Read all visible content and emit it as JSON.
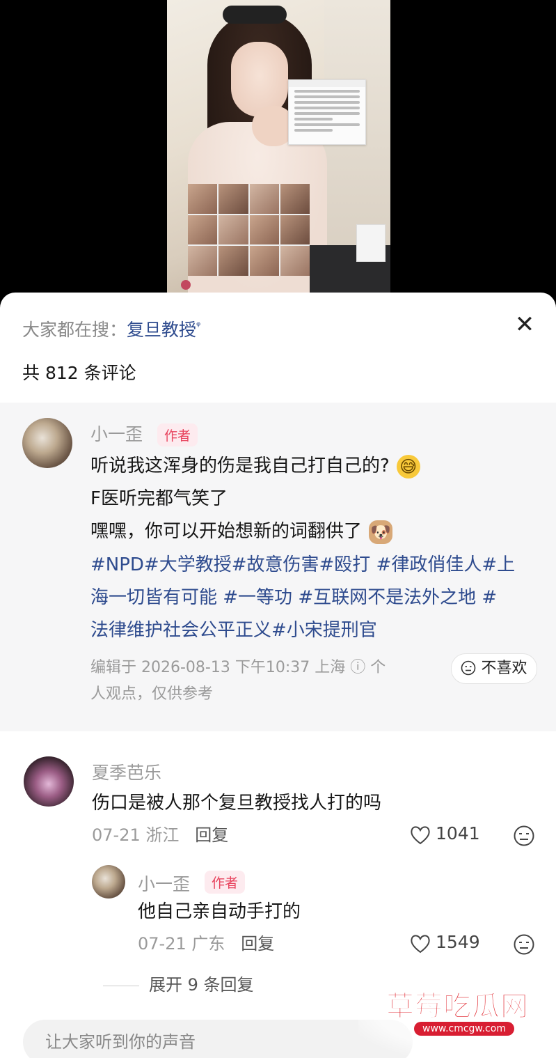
{
  "sheet": {
    "search_prefix": "大家都在搜：",
    "search_keyword": "复旦教授",
    "search_icon": "ᵠ",
    "close_icon": "✕",
    "comment_count": "共 812 条评论"
  },
  "pinned": {
    "username": "小一歪",
    "badge": "作者",
    "line1": "听说我这浑身的伤是我自己打自己的?",
    "line2": "F医听完都气笑了",
    "line3": "嘿嘿，你可以开始想新的词翻供了",
    "hashtag_line1": "#NPD#大学教授#故意伤害#殴打 #律政俏佳人#上",
    "hashtag_line2": "海一切皆有可能 #一等功 #互联网不是法外之地 #",
    "hashtag_line3": "法律维护社会公平正义#小宋提刑官",
    "meta_line1": "编辑于  2026-08-13 下午10:37 上海",
    "meta_info_icon": "ⓘ",
    "meta_tail1": " 个",
    "meta_line2": "人观点，仅供参考",
    "dislike_label": "不喜欢",
    "emoji1": "😅",
    "emoji2": "🐶"
  },
  "comments": [
    {
      "username": "夏季芭乐",
      "text": "伤口是被人那个复旦教授找人打的吗",
      "date_loc": "07-21 浙江",
      "reply": "回复",
      "likes": "1041"
    }
  ],
  "reply": {
    "username": "小一歪",
    "badge": "作者",
    "text": "他自己亲自动手打的",
    "date_loc": "07-21 广东",
    "reply": "回复",
    "likes": "1549"
  },
  "expand_label": "展开 9 条回复",
  "input_placeholder": "让大家听到你的声音",
  "watermark": {
    "title": "草莓吃瓜网",
    "url": "www.cmcgw.com"
  },
  "colors": {
    "link_blue": "#2e4b8e",
    "author_red": "#e8455f"
  }
}
